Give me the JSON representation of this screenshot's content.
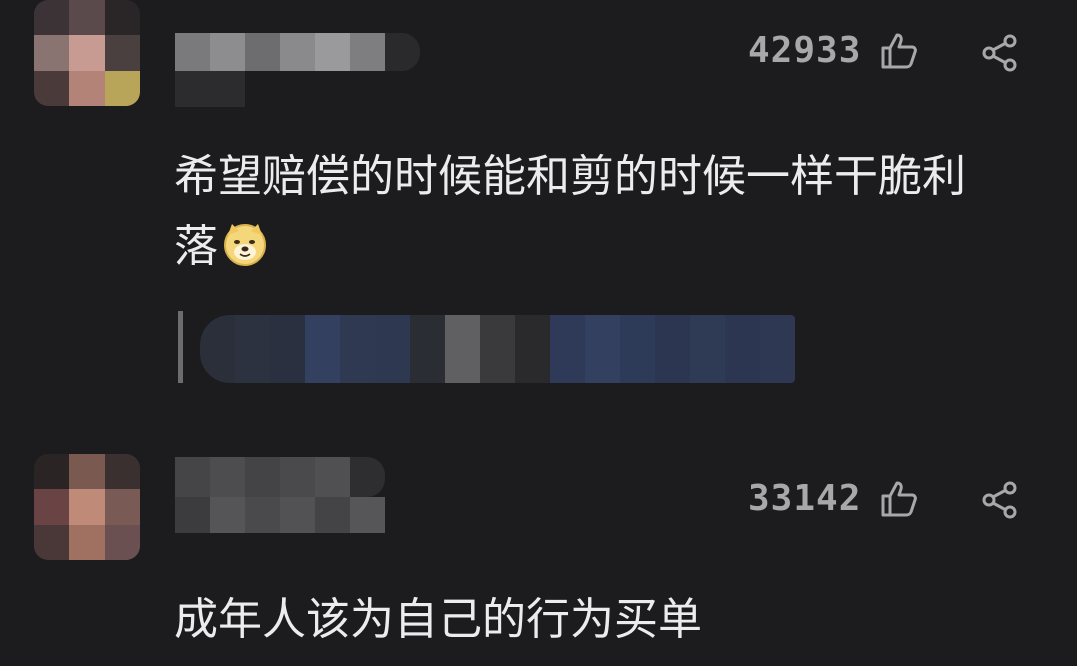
{
  "comments": [
    {
      "likes": "42933",
      "text_line1": "希望赔偿的时候能和剪的时候一样干脆利",
      "text_line2": "落",
      "emoji": "doge-emoji",
      "like_icon": "thumbs-up-outline-icon",
      "share_icon": "share-icon",
      "has_reply_preview": true
    },
    {
      "likes": "33142",
      "text_line1": "成年人该为自己的行为买单",
      "like_icon": "thumbs-up-outline-icon",
      "share_icon": "share-icon"
    }
  ],
  "colors": {
    "background": "#1c1c1e",
    "text": "#ececec",
    "meta": "#a8a8aa"
  }
}
